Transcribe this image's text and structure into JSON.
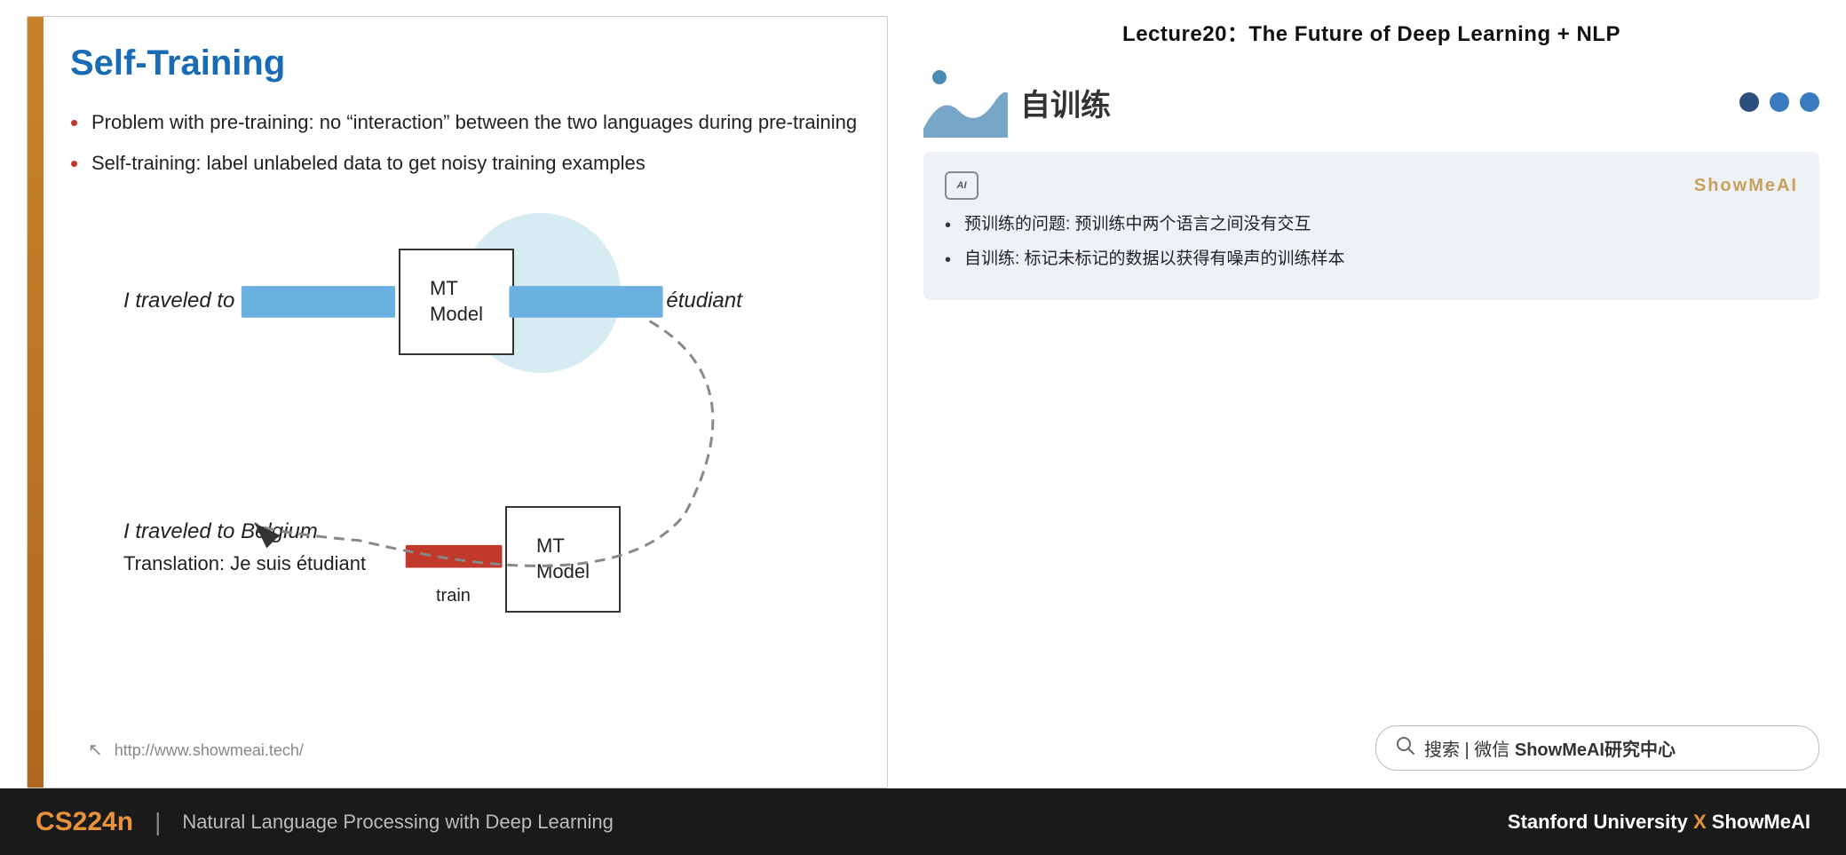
{
  "lecture": {
    "title": "Lecture20：The Future of Deep Learning + NLP"
  },
  "slide": {
    "title": "Self-Training",
    "bullets": [
      "Problem with pre-training: no “interaction” between the two languages during pre-training",
      "Self-training: label unlabeled data to get noisy training examples"
    ],
    "diagram": {
      "label_left_top": "I traveled to Belgium",
      "label_right_top": "Je suis étudiant",
      "label_left_bottom": "I traveled to Belgium",
      "label_translation": "Translation: Je suis étudiant",
      "label_train": "train",
      "mt_model_label": "MT\nModel"
    },
    "url": "http://www.showmeai.tech/"
  },
  "right_panel": {
    "section_title": "自训练",
    "dots": [
      "dark",
      "medium",
      "medium"
    ],
    "card": {
      "showmeai_label": "ShowMeAI",
      "bullets": [
        "预训练的问题: 预训练中两个语言之间没有交互",
        "自训练: 标记未标记的数据以获得有噪声的训练样本"
      ]
    },
    "search": {
      "text": "搜索 | 微信 ShowMeAI研究中心"
    }
  },
  "footer": {
    "course_code": "CS224n",
    "divider": "|",
    "course_name": "Natural Language Processing with Deep Learning",
    "university": "Stanford University",
    "x_mark": "X",
    "brand": "ShowMeAI"
  }
}
